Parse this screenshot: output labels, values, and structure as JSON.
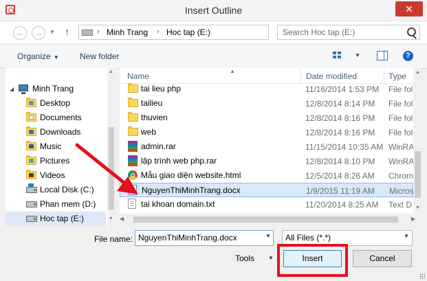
{
  "window": {
    "title": "Insert Outline",
    "close_glyph": "✕"
  },
  "nav": {
    "back_icon": "back-arrow-icon",
    "forward_icon": "forward-arrow-icon",
    "up_icon": "up-arrow-icon"
  },
  "address": {
    "crumbs": [
      "Minh Trang",
      "Hoc tap (E:)"
    ],
    "separator": "›"
  },
  "search": {
    "placeholder": "Search Hoc tap (E:)"
  },
  "toolbar": {
    "organize": "Organize",
    "new_folder": "New folder",
    "help": "?"
  },
  "sidebar": {
    "items": [
      {
        "label": "Minh Trang",
        "icon": "computer-icon"
      },
      {
        "label": "Desktop",
        "icon": "folder-icon"
      },
      {
        "label": "Documents",
        "icon": "folder-icon"
      },
      {
        "label": "Downloads",
        "icon": "folder-icon"
      },
      {
        "label": "Music",
        "icon": "folder-icon"
      },
      {
        "label": "Pictures",
        "icon": "folder-icon"
      },
      {
        "label": "Videos",
        "icon": "folder-icon"
      },
      {
        "label": "Local Disk (C:)",
        "icon": "drive-icon"
      },
      {
        "label": "Phan mem (D:)",
        "icon": "drive-icon"
      },
      {
        "label": "Hoc tap (E:)",
        "icon": "drive-icon",
        "selected": true
      }
    ]
  },
  "columns": {
    "name": "Name",
    "date": "Date modified",
    "type": "Type"
  },
  "files": [
    {
      "name": "tai lieu php",
      "date": "11/16/2014 1:53 PM",
      "type": "File fold",
      "icon": "folder-icon"
    },
    {
      "name": "tailieu",
      "date": "12/8/2014 8:14 PM",
      "type": "File fold",
      "icon": "folder-icon"
    },
    {
      "name": "thuvien",
      "date": "12/8/2014 8:16 PM",
      "type": "File fold",
      "icon": "folder-icon"
    },
    {
      "name": "web",
      "date": "12/8/2014 8:16 PM",
      "type": "File fold",
      "icon": "folder-icon"
    },
    {
      "name": "admin.rar",
      "date": "11/15/2014 10:35 AM",
      "type": "WinRA",
      "icon": "rar-icon"
    },
    {
      "name": "lập trình web php.rar",
      "date": "12/8/2014 8:10 PM",
      "type": "WinRA",
      "icon": "rar-icon"
    },
    {
      "name": "Mẫu giao diện website.html",
      "date": "12/5/2014 8:26 AM",
      "type": "Chrom",
      "icon": "chrome-icon"
    },
    {
      "name": "NguyenThiMinhTrang.docx",
      "date": "1/9/2015 11:19 AM",
      "type": "Micros",
      "icon": "word-doc-icon",
      "selected": true
    },
    {
      "name": "tai khoan domain.txt",
      "date": "11/20/2014 8:25 AM",
      "type": "Text D",
      "icon": "text-file-icon"
    }
  ],
  "bottom": {
    "file_name_label": "File name:",
    "file_name_value": "NguyenThiMinhTrang.docx",
    "filter_value": "All Files (*.*)",
    "tools_label": "Tools",
    "insert_label": "Insert",
    "cancel_label": "Cancel"
  },
  "colors": {
    "annotation_red": "#e60f1e",
    "selection_bg": "#d9e8f8",
    "close_red": "#c93b32"
  }
}
